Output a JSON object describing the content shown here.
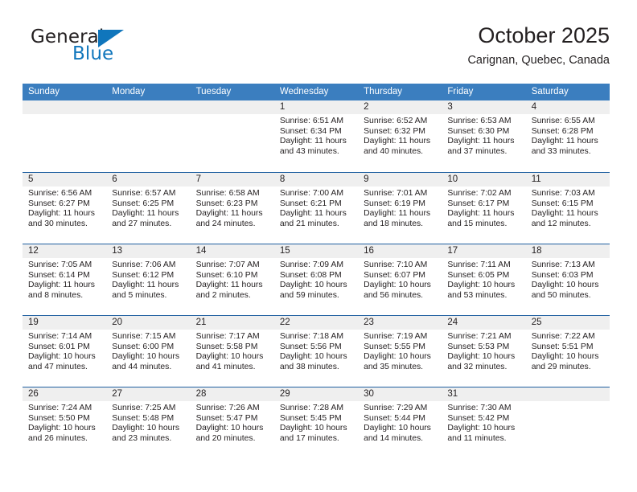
{
  "logo": {
    "word_one": "General",
    "word_two": "Blue",
    "accent_color": "#1076bc"
  },
  "header": {
    "title": "October 2025",
    "subtitle": "Carignan, Quebec, Canada",
    "band_color": "#3b7ebf",
    "rule_color": "#1f5fa0",
    "daynum_bg": "#efefef"
  },
  "weekday_headers": [
    "Sunday",
    "Monday",
    "Tuesday",
    "Wednesday",
    "Thursday",
    "Friday",
    "Saturday"
  ],
  "weeks": [
    [
      {
        "day": "",
        "sunrise": "",
        "sunset": "",
        "daylight": "",
        "empty": true
      },
      {
        "day": "",
        "sunrise": "",
        "sunset": "",
        "daylight": "",
        "empty": true
      },
      {
        "day": "",
        "sunrise": "",
        "sunset": "",
        "daylight": "",
        "empty": true
      },
      {
        "day": "1",
        "sunrise": "Sunrise: 6:51 AM",
        "sunset": "Sunset: 6:34 PM",
        "daylight": "Daylight: 11 hours and 43 minutes."
      },
      {
        "day": "2",
        "sunrise": "Sunrise: 6:52 AM",
        "sunset": "Sunset: 6:32 PM",
        "daylight": "Daylight: 11 hours and 40 minutes."
      },
      {
        "day": "3",
        "sunrise": "Sunrise: 6:53 AM",
        "sunset": "Sunset: 6:30 PM",
        "daylight": "Daylight: 11 hours and 37 minutes."
      },
      {
        "day": "4",
        "sunrise": "Sunrise: 6:55 AM",
        "sunset": "Sunset: 6:28 PM",
        "daylight": "Daylight: 11 hours and 33 minutes."
      }
    ],
    [
      {
        "day": "5",
        "sunrise": "Sunrise: 6:56 AM",
        "sunset": "Sunset: 6:27 PM",
        "daylight": "Daylight: 11 hours and 30 minutes."
      },
      {
        "day": "6",
        "sunrise": "Sunrise: 6:57 AM",
        "sunset": "Sunset: 6:25 PM",
        "daylight": "Daylight: 11 hours and 27 minutes."
      },
      {
        "day": "7",
        "sunrise": "Sunrise: 6:58 AM",
        "sunset": "Sunset: 6:23 PM",
        "daylight": "Daylight: 11 hours and 24 minutes."
      },
      {
        "day": "8",
        "sunrise": "Sunrise: 7:00 AM",
        "sunset": "Sunset: 6:21 PM",
        "daylight": "Daylight: 11 hours and 21 minutes."
      },
      {
        "day": "9",
        "sunrise": "Sunrise: 7:01 AM",
        "sunset": "Sunset: 6:19 PM",
        "daylight": "Daylight: 11 hours and 18 minutes."
      },
      {
        "day": "10",
        "sunrise": "Sunrise: 7:02 AM",
        "sunset": "Sunset: 6:17 PM",
        "daylight": "Daylight: 11 hours and 15 minutes."
      },
      {
        "day": "11",
        "sunrise": "Sunrise: 7:03 AM",
        "sunset": "Sunset: 6:15 PM",
        "daylight": "Daylight: 11 hours and 12 minutes."
      }
    ],
    [
      {
        "day": "12",
        "sunrise": "Sunrise: 7:05 AM",
        "sunset": "Sunset: 6:14 PM",
        "daylight": "Daylight: 11 hours and 8 minutes."
      },
      {
        "day": "13",
        "sunrise": "Sunrise: 7:06 AM",
        "sunset": "Sunset: 6:12 PM",
        "daylight": "Daylight: 11 hours and 5 minutes."
      },
      {
        "day": "14",
        "sunrise": "Sunrise: 7:07 AM",
        "sunset": "Sunset: 6:10 PM",
        "daylight": "Daylight: 11 hours and 2 minutes."
      },
      {
        "day": "15",
        "sunrise": "Sunrise: 7:09 AM",
        "sunset": "Sunset: 6:08 PM",
        "daylight": "Daylight: 10 hours and 59 minutes."
      },
      {
        "day": "16",
        "sunrise": "Sunrise: 7:10 AM",
        "sunset": "Sunset: 6:07 PM",
        "daylight": "Daylight: 10 hours and 56 minutes."
      },
      {
        "day": "17",
        "sunrise": "Sunrise: 7:11 AM",
        "sunset": "Sunset: 6:05 PM",
        "daylight": "Daylight: 10 hours and 53 minutes."
      },
      {
        "day": "18",
        "sunrise": "Sunrise: 7:13 AM",
        "sunset": "Sunset: 6:03 PM",
        "daylight": "Daylight: 10 hours and 50 minutes."
      }
    ],
    [
      {
        "day": "19",
        "sunrise": "Sunrise: 7:14 AM",
        "sunset": "Sunset: 6:01 PM",
        "daylight": "Daylight: 10 hours and 47 minutes."
      },
      {
        "day": "20",
        "sunrise": "Sunrise: 7:15 AM",
        "sunset": "Sunset: 6:00 PM",
        "daylight": "Daylight: 10 hours and 44 minutes."
      },
      {
        "day": "21",
        "sunrise": "Sunrise: 7:17 AM",
        "sunset": "Sunset: 5:58 PM",
        "daylight": "Daylight: 10 hours and 41 minutes."
      },
      {
        "day": "22",
        "sunrise": "Sunrise: 7:18 AM",
        "sunset": "Sunset: 5:56 PM",
        "daylight": "Daylight: 10 hours and 38 minutes."
      },
      {
        "day": "23",
        "sunrise": "Sunrise: 7:19 AM",
        "sunset": "Sunset: 5:55 PM",
        "daylight": "Daylight: 10 hours and 35 minutes."
      },
      {
        "day": "24",
        "sunrise": "Sunrise: 7:21 AM",
        "sunset": "Sunset: 5:53 PM",
        "daylight": "Daylight: 10 hours and 32 minutes."
      },
      {
        "day": "25",
        "sunrise": "Sunrise: 7:22 AM",
        "sunset": "Sunset: 5:51 PM",
        "daylight": "Daylight: 10 hours and 29 minutes."
      }
    ],
    [
      {
        "day": "26",
        "sunrise": "Sunrise: 7:24 AM",
        "sunset": "Sunset: 5:50 PM",
        "daylight": "Daylight: 10 hours and 26 minutes."
      },
      {
        "day": "27",
        "sunrise": "Sunrise: 7:25 AM",
        "sunset": "Sunset: 5:48 PM",
        "daylight": "Daylight: 10 hours and 23 minutes."
      },
      {
        "day": "28",
        "sunrise": "Sunrise: 7:26 AM",
        "sunset": "Sunset: 5:47 PM",
        "daylight": "Daylight: 10 hours and 20 minutes."
      },
      {
        "day": "29",
        "sunrise": "Sunrise: 7:28 AM",
        "sunset": "Sunset: 5:45 PM",
        "daylight": "Daylight: 10 hours and 17 minutes."
      },
      {
        "day": "30",
        "sunrise": "Sunrise: 7:29 AM",
        "sunset": "Sunset: 5:44 PM",
        "daylight": "Daylight: 10 hours and 14 minutes."
      },
      {
        "day": "31",
        "sunrise": "Sunrise: 7:30 AM",
        "sunset": "Sunset: 5:42 PM",
        "daylight": "Daylight: 10 hours and 11 minutes."
      },
      {
        "day": "",
        "sunrise": "",
        "sunset": "",
        "daylight": "",
        "empty": true
      }
    ]
  ]
}
